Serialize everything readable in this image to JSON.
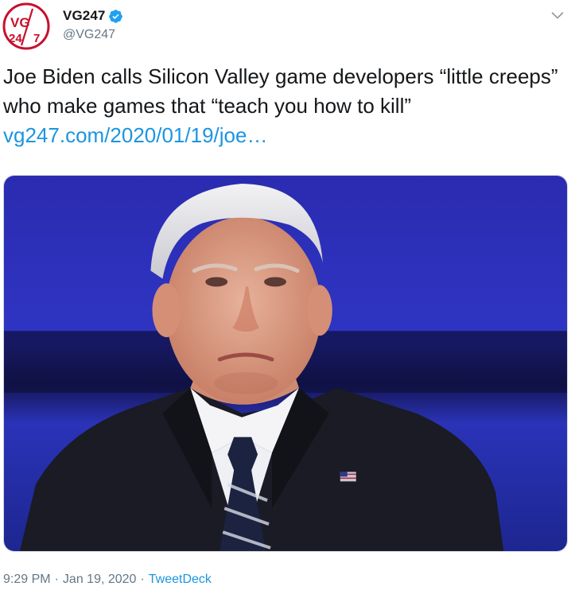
{
  "account": {
    "display_name": "VG247",
    "handle": "@VG247",
    "verified": true,
    "avatar_text_top": "VG",
    "avatar_text_bottom_left": "24",
    "avatar_text_bottom_right": "7",
    "brand_color": "#c8102e"
  },
  "tweet": {
    "text_line": "Joe Biden calls Silicon Valley game developers “little creeps” who make games that “teach you how to kill”",
    "link_text": "vg247.com/2020/01/19/joe…",
    "link_color": "#1b95e0"
  },
  "media": {
    "icon": "photo",
    "flag_icon": "us-flag-pin-icon"
  },
  "footer": {
    "time": "9:29 PM",
    "separator_1": "·",
    "date": "Jan 19, 2020",
    "separator_2": "·",
    "source": "TweetDeck"
  }
}
